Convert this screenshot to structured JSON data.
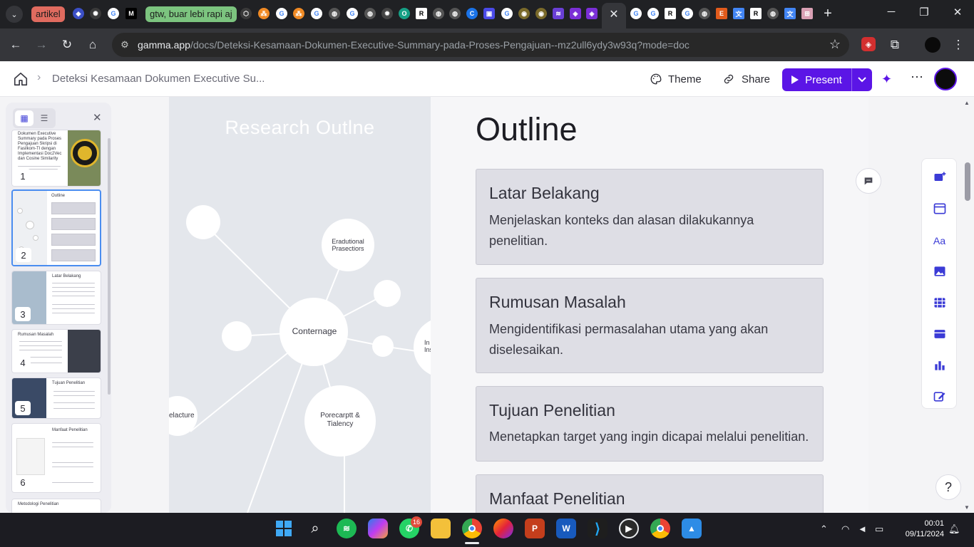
{
  "browser": {
    "tab_groups": [
      {
        "label": "artikel",
        "color": "#e06b5f"
      },
      {
        "label": "gtw, buar lebi rapi aj",
        "color": "#7cc47f"
      }
    ],
    "url_host": "gamma.app",
    "url_path": "/docs/Deteksi-Kesamaan-Dokumen-Executive-Summary-pada-Proses-Pengajuan--mz2ull6ydy3w93q?mode=doc"
  },
  "header": {
    "doc_title": "Deteksi Kesamaan Dokumen Executive Su...",
    "theme_label": "Theme",
    "share_label": "Share",
    "present_label": "Present"
  },
  "sidebar": {
    "slides": [
      {
        "num": "1",
        "title": "Dokumen Executive Summary pada Proses Pengajuan Skripsi di Fasilkom-TI dengan Implementasi Doc2Vec dan Cosine Similarity"
      },
      {
        "num": "2",
        "title": "Outline"
      },
      {
        "num": "3",
        "title": "Latar Belakang"
      },
      {
        "num": "4",
        "title": "Rumusan Masalah"
      },
      {
        "num": "5",
        "title": "Tujuan Penelitian"
      },
      {
        "num": "6",
        "title": "Manfaat Penelitian"
      },
      {
        "num": "7",
        "title": "Metodologi Penelitian"
      }
    ]
  },
  "card": {
    "image_title": "Research Outlne",
    "image_nodes": [
      "Conternage",
      "Eradutional Prasectiors",
      "Porecarptt & Tialency",
      "elacture",
      "In Ins"
    ],
    "heading": "Outline",
    "items": [
      {
        "title": "Latar Belakang",
        "desc": "Menjelaskan konteks dan alasan dilakukannya penelitian."
      },
      {
        "title": "Rumusan Masalah",
        "desc": "Mengidentifikasi permasalahan utama yang akan diselesaikan."
      },
      {
        "title": "Tujuan Penelitian",
        "desc": "Menetapkan target yang ingin dicapai melalui penelitian."
      },
      {
        "title": "Manfaat Penelitian",
        "desc": ""
      }
    ]
  },
  "help_label": "?",
  "taskbar": {
    "whatsapp_badge": "16",
    "time": "00:01",
    "date": "09/11/2024"
  },
  "colors": {
    "accent": "#5b15e6",
    "item_bg": "#dedee5"
  }
}
